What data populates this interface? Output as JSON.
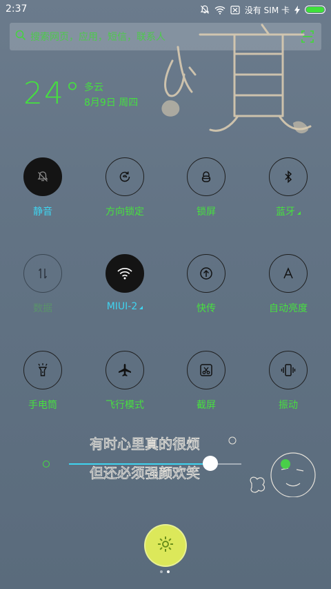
{
  "status_bar": {
    "time": "2:37",
    "carrier_text": "没有 SIM 卡",
    "icons": [
      "silent-bell-icon",
      "wifi-icon",
      "no-sim-icon",
      "charging-icon",
      "battery-icon"
    ],
    "battery_color": "#3fe03a"
  },
  "search": {
    "placeholder": "搜索网页，应用，短信，联系人",
    "scan_icon": "scan-icon"
  },
  "weather": {
    "temperature": "24°",
    "condition": "多云",
    "date": "8月9日 周四"
  },
  "toggles": [
    {
      "id": "mute",
      "label": "静音",
      "icon": "mute-icon",
      "state": "on",
      "label_color": "cyan"
    },
    {
      "id": "rotation",
      "label": "方向锁定",
      "icon": "rotation-lock-icon",
      "state": "off",
      "label_color": "green"
    },
    {
      "id": "lock",
      "label": "锁屏",
      "icon": "lock-icon",
      "state": "off",
      "label_color": "green"
    },
    {
      "id": "bluetooth",
      "label": "蓝牙",
      "icon": "bluetooth-icon",
      "state": "off",
      "label_color": "green",
      "has_more": true
    },
    {
      "id": "data",
      "label": "数据",
      "icon": "data-icon",
      "state": "disabled",
      "label_color": "dim"
    },
    {
      "id": "wifi",
      "label": "MIUI-2",
      "icon": "wifi-icon",
      "state": "on",
      "label_color": "cyan",
      "has_more": true
    },
    {
      "id": "transfer",
      "label": "快传",
      "icon": "transfer-icon",
      "state": "off",
      "label_color": "green"
    },
    {
      "id": "auto_brightness",
      "label": "自动亮度",
      "icon": "auto-brightness-icon",
      "state": "off",
      "label_color": "green"
    },
    {
      "id": "flashlight",
      "label": "手电筒",
      "icon": "flashlight-icon",
      "state": "off",
      "label_color": "green"
    },
    {
      "id": "airplane",
      "label": "飞行模式",
      "icon": "airplane-icon",
      "state": "off",
      "label_color": "green"
    },
    {
      "id": "screenshot",
      "label": "截屏",
      "icon": "screenshot-icon",
      "state": "off",
      "label_color": "green"
    },
    {
      "id": "vibrate",
      "label": "振动",
      "icon": "vibrate-icon",
      "state": "off",
      "label_color": "green"
    }
  ],
  "brightness": {
    "level": 0.82
  },
  "wallpaper_text": {
    "big_char": "烦",
    "line1": "有时心里真的很烦",
    "line2": "但还必须强颜欢笑"
  },
  "settings_button": {
    "icon": "gear-icon",
    "color": "#dce85a"
  },
  "pager": {
    "pages": 2,
    "current": 2
  },
  "colors": {
    "accent_green": "#45e03f",
    "accent_cyan": "#3fd4f0"
  }
}
